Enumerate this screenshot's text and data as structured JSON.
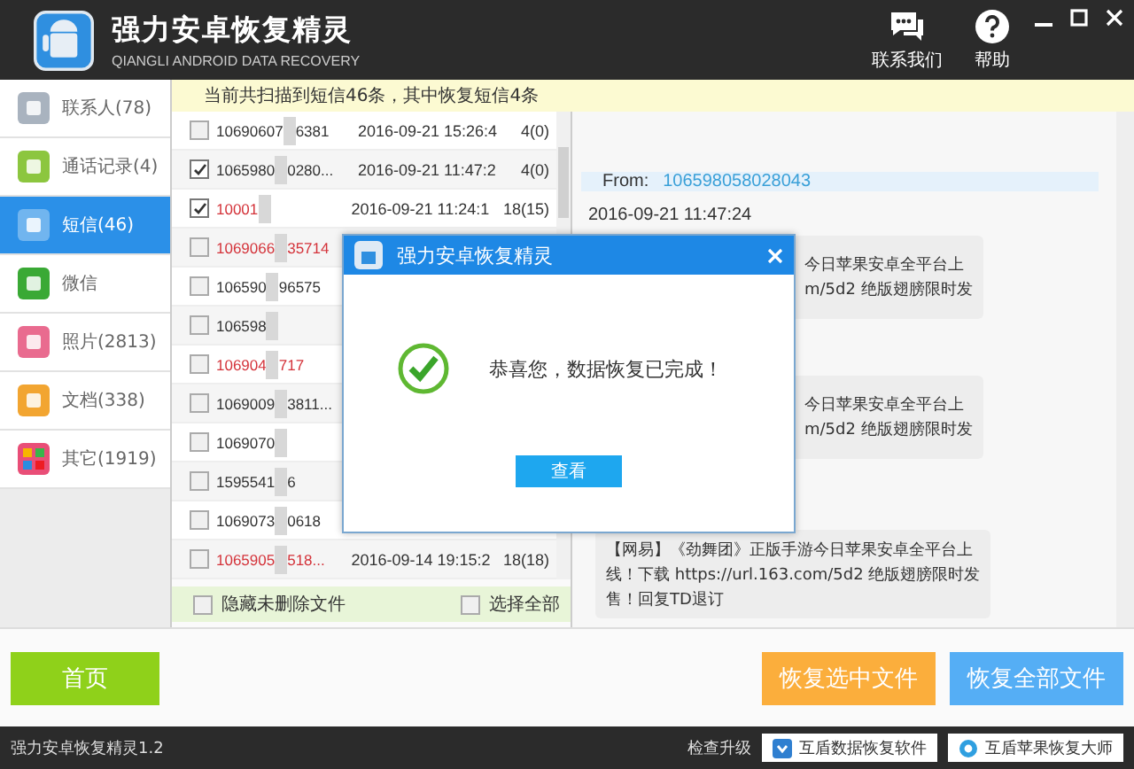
{
  "window": {
    "title": "强力安卓恢复精灵",
    "subtitle": "QIANGLI ANDROID DATA RECOVERY",
    "actions": [
      {
        "kind": "contact",
        "label": "联系我们"
      },
      {
        "kind": "help",
        "label": "帮助"
      }
    ]
  },
  "sidebar": {
    "items": [
      {
        "label": "联系人(78)",
        "kind": "contacts",
        "selected": false
      },
      {
        "label": "通话记录(4)",
        "kind": "calls",
        "selected": false
      },
      {
        "label": "短信(46)",
        "kind": "sms",
        "selected": true
      },
      {
        "label": "微信",
        "kind": "wechat",
        "selected": false
      },
      {
        "label": "照片(2813)",
        "kind": "photos",
        "selected": false
      },
      {
        "label": "文档(338)",
        "kind": "docs",
        "selected": false
      },
      {
        "label": "其它(1919)",
        "kind": "other",
        "selected": false
      }
    ]
  },
  "banner": "当前共扫描到短信46条，其中恢复短信4条",
  "messages": {
    "rows": [
      {
        "number": "10690607",
        "number_end": "6381",
        "time": "2016-09-21 15:26:4",
        "count": "4(0)",
        "checked": false,
        "recovered": false
      },
      {
        "number": "1065980",
        "number_end": "0280...",
        "time": "2016-09-21 11:47:2",
        "count": "4(0)",
        "checked": true,
        "recovered": false
      },
      {
        "number": "10001",
        "time": "2016-09-21 11:24:1",
        "count": "18(15)",
        "checked": true,
        "recovered": true
      },
      {
        "number": "1069066",
        "number_end": "35714",
        "checked": false,
        "recovered": true
      },
      {
        "number": "106590",
        "number_end": "96575",
        "checked": false,
        "recovered": false
      },
      {
        "number": "106598",
        "checked": false,
        "recovered": false
      },
      {
        "number": "106904",
        "number_end": "717",
        "checked": false,
        "recovered": true
      },
      {
        "number": "1069009",
        "number_end": "3811...",
        "checked": false,
        "recovered": false
      },
      {
        "number": "1069070",
        "checked": false,
        "recovered": false
      },
      {
        "number": "1595541",
        "number_end": "6",
        "checked": false,
        "recovered": false
      },
      {
        "number": "1069073",
        "number_end": "0618",
        "checked": false,
        "recovered": false
      },
      {
        "number": "1065905",
        "number_end": "518...",
        "time": "2016-09-14 19:15:2",
        "count": "18(18)",
        "checked": false,
        "recovered": true
      }
    ],
    "hide_undeleted": {
      "label": "隐藏未删除文件",
      "checked": false
    },
    "select_all": {
      "label": "选择全部",
      "checked": false
    }
  },
  "detail": {
    "from_label": "From:",
    "from": "106598058028043",
    "date": "2016-09-21 11:47:24",
    "bubbles": [
      {
        "kind": "partial",
        "lines": [
          "今日苹果安卓全平台上",
          "m/5d2 绝版翅膀限时发"
        ]
      },
      {
        "kind": "partial",
        "lines": [
          "今日苹果安卓全平台上",
          "m/5d2 绝版翅膀限时发"
        ]
      },
      {
        "kind": "full",
        "lines": [
          "【网易】《劲舞团》正版手游今日苹果安卓全平台上",
          "线！下载 https://url.163.com/5d2 绝版翅膀限时发",
          "售！回复TD退订"
        ]
      }
    ]
  },
  "dialog": {
    "title": "强力安卓恢复精灵",
    "message": "恭喜您，数据恢复已完成！",
    "button": "查看"
  },
  "buttons": [
    {
      "kind": "home",
      "label": "首页"
    },
    {
      "kind": "selected",
      "label": "恢复选中文件"
    },
    {
      "kind": "all",
      "label": "恢复全部文件"
    }
  ],
  "status_bar": {
    "version": "强力安卓恢复精灵1.2",
    "update": "检查升级",
    "links": [
      "互盾数据恢复软件",
      "互盾苹果恢复大师"
    ]
  }
}
